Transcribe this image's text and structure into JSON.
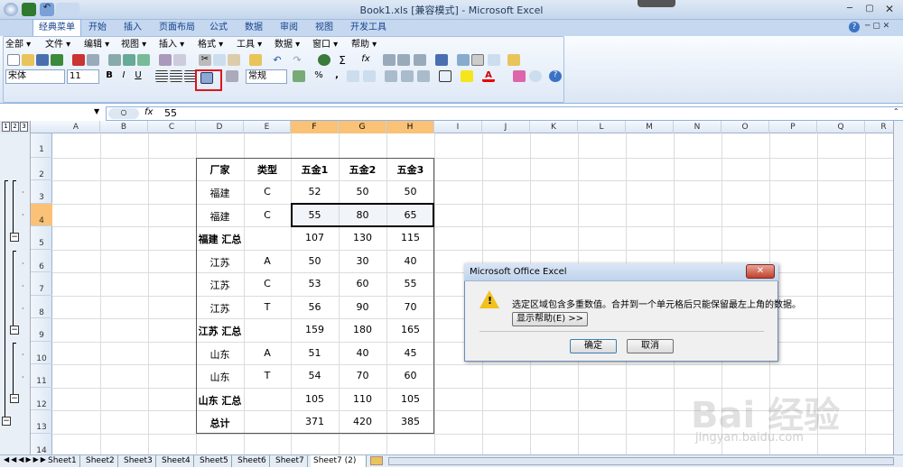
{
  "window": {
    "title": "Book1.xls [兼容模式] - Microsoft Excel"
  },
  "ribbon_tabs": [
    "经典菜单",
    "开始",
    "插入",
    "页面布局",
    "公式",
    "数据",
    "审阅",
    "视图",
    "开发工具"
  ],
  "menus": [
    "全部 ▾",
    "文件 ▾",
    "编辑 ▾",
    "视图 ▾",
    "插入 ▾",
    "格式 ▾",
    "工具 ▾",
    "数据 ▾",
    "窗口 ▾",
    "帮助 ▾"
  ],
  "font": {
    "name": "宋体",
    "size": "11",
    "style": "常规"
  },
  "formula": {
    "fx": "fx",
    "value": "55"
  },
  "columns": [
    "A",
    "B",
    "C",
    "D",
    "E",
    "F",
    "G",
    "H",
    "I",
    "J",
    "K",
    "L",
    "M",
    "N",
    "O",
    "P",
    "Q",
    "R"
  ],
  "rows": [
    "1",
    "2",
    "3",
    "4",
    "5",
    "6",
    "7",
    "8",
    "9",
    "10",
    "11",
    "12",
    "13",
    "14"
  ],
  "table": {
    "header": [
      "厂家",
      "类型",
      "五金1",
      "五金2",
      "五金3"
    ],
    "r3": [
      "福建",
      "C",
      "52",
      "50",
      "50"
    ],
    "r4": [
      "福建",
      "C",
      "55",
      "80",
      "65"
    ],
    "r5": [
      "福建 汇总",
      "",
      "107",
      "130",
      "115"
    ],
    "r6": [
      "江苏",
      "A",
      "50",
      "30",
      "40"
    ],
    "r7": [
      "江苏",
      "C",
      "53",
      "60",
      "55"
    ],
    "r8": [
      "江苏",
      "T",
      "56",
      "90",
      "70"
    ],
    "r9": [
      "江苏 汇总",
      "",
      "159",
      "180",
      "165"
    ],
    "r10": [
      "山东",
      "A",
      "51",
      "40",
      "45"
    ],
    "r11": [
      "山东",
      "T",
      "54",
      "70",
      "60"
    ],
    "r12": [
      "山东 汇总",
      "",
      "105",
      "110",
      "105"
    ],
    "r13": [
      "总计",
      "",
      "371",
      "420",
      "385"
    ]
  },
  "outline_levels": [
    "1",
    "2",
    "3"
  ],
  "sheets": [
    "Sheet1",
    "Sheet2",
    "Sheet3",
    "Sheet4",
    "Sheet5",
    "Sheet6",
    "Sheet7",
    "Sheet7 (2)"
  ],
  "dialog": {
    "title": "Microsoft Office Excel",
    "message": "选定区域包含多重数值。合并到一个单元格后只能保留最左上角的数据。",
    "help_button": "显示帮助(E) >>",
    "ok": "确定",
    "cancel": "取消"
  },
  "watermark": {
    "brand": "Bai 经验",
    "url": "jingyan.baidu.com"
  }
}
